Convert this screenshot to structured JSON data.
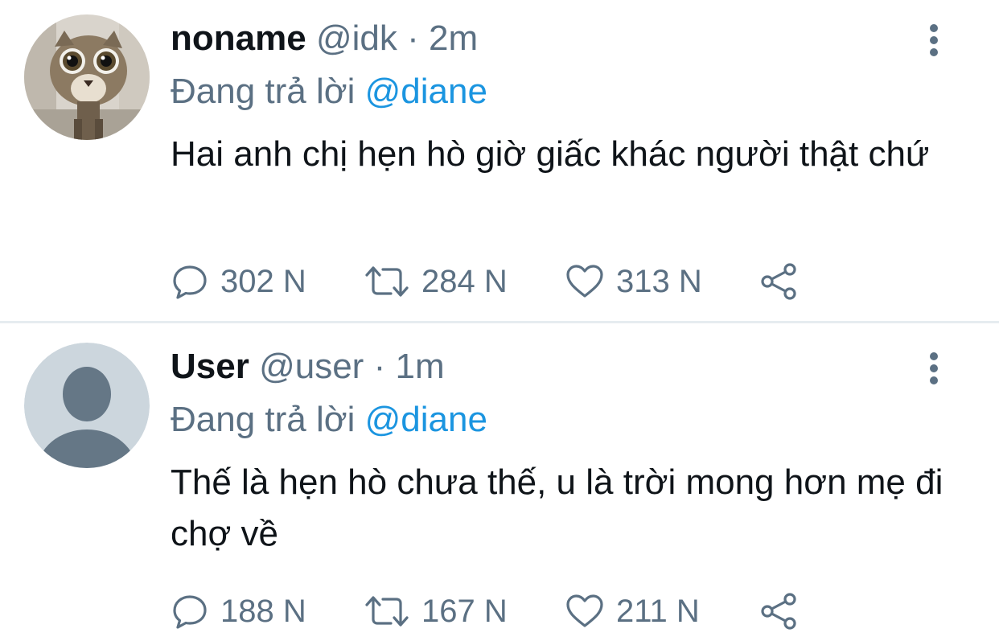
{
  "reply_prefix": "Đang trả lời",
  "colors": {
    "text": "#0f1419",
    "secondary": "#5b7083",
    "mention": "#1b95e0",
    "divider": "#e6ecf0",
    "default_avatar_bg": "#ccd6dd",
    "default_avatar_fg": "#657786"
  },
  "tweets": [
    {
      "avatar_icon": "cat-photo-avatar",
      "display_name": "noname",
      "handle": "@idk",
      "separator": "·",
      "time": "2m",
      "reply_to": "@diane",
      "text": "Hai anh chị hẹn hò giờ giấc khác người thật chứ",
      "stats": {
        "replies": "302 N",
        "retweets": "284 N",
        "likes": "313 N"
      }
    },
    {
      "avatar_icon": "default-user-avatar",
      "display_name": "User",
      "handle": "@user",
      "separator": "·",
      "time": "1m",
      "reply_to": "@diane",
      "text": "Thế là hẹn hò chưa thế, u là trời mong hơn mẹ đi chợ về",
      "stats": {
        "replies": "188 N",
        "retweets": "167 N",
        "likes": "211 N"
      }
    }
  ]
}
